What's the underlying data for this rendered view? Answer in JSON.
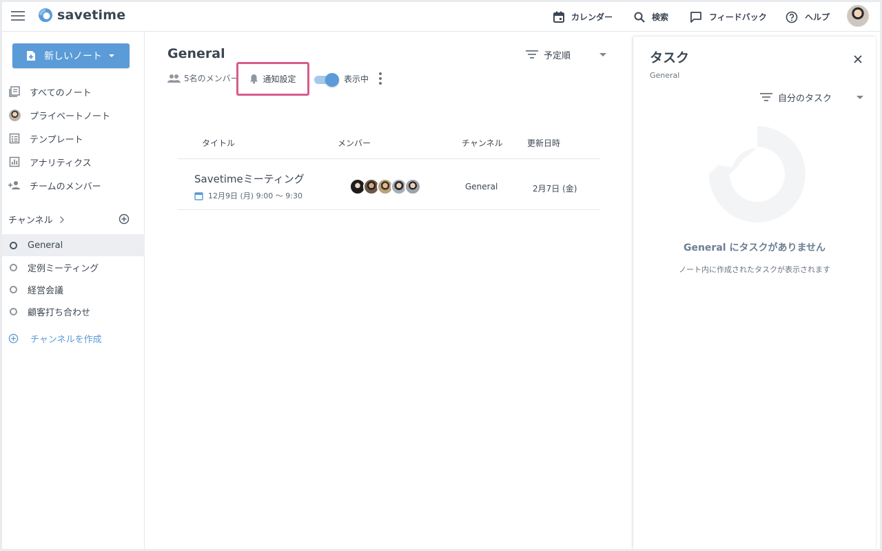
{
  "app": {
    "name": "savetime"
  },
  "header": {
    "nav": [
      {
        "label": "カレンダー",
        "icon": "calendar-icon"
      },
      {
        "label": "検索",
        "icon": "search-icon"
      },
      {
        "label": "フィードバック",
        "icon": "feedback-icon"
      },
      {
        "label": "ヘルプ",
        "icon": "help-icon"
      }
    ]
  },
  "sidebar": {
    "new_note_label": "新しいノート",
    "items": [
      {
        "label": "すべてのノート",
        "icon": "notes-icon"
      },
      {
        "label": "プライベートノート",
        "icon": "user-avatar"
      },
      {
        "label": "テンプレート",
        "icon": "template-icon"
      },
      {
        "label": "アナリティクス",
        "icon": "analytics-icon"
      },
      {
        "label": "チームのメンバー",
        "icon": "add-member-icon"
      }
    ],
    "channels_title": "チャンネル",
    "channels": [
      {
        "label": "General",
        "active": true
      },
      {
        "label": "定例ミーティング",
        "active": false
      },
      {
        "label": "経営会議",
        "active": false
      },
      {
        "label": "顧客打ち合わせ",
        "active": false
      }
    ],
    "create_channel_label": "チャンネルを作成"
  },
  "main": {
    "title": "General",
    "members_label": "5名のメンバー",
    "notification_label": "通知設定",
    "toggle_label": "表示中",
    "toggle_on": true,
    "sort_label": "予定順",
    "columns": [
      "タイトル",
      "メンバー",
      "チャンネル",
      "更新日時"
    ],
    "rows": [
      {
        "title": "Savetimeミーティング",
        "date": "12月9日 (月) 9:00 〜 9:30",
        "member_count": 5,
        "channel": "General",
        "updated": "2月7日 (金)"
      }
    ]
  },
  "task_panel": {
    "title": "タスク",
    "subtitle": "General",
    "filter_label": "自分のタスク",
    "empty_title": "General にタスクがありません",
    "empty_desc": "ノート内に作成されたタスクが表示されます"
  },
  "colors": {
    "accent": "#5a9bd8",
    "highlight_border": "#d85a8a",
    "text": "#3c4652"
  }
}
